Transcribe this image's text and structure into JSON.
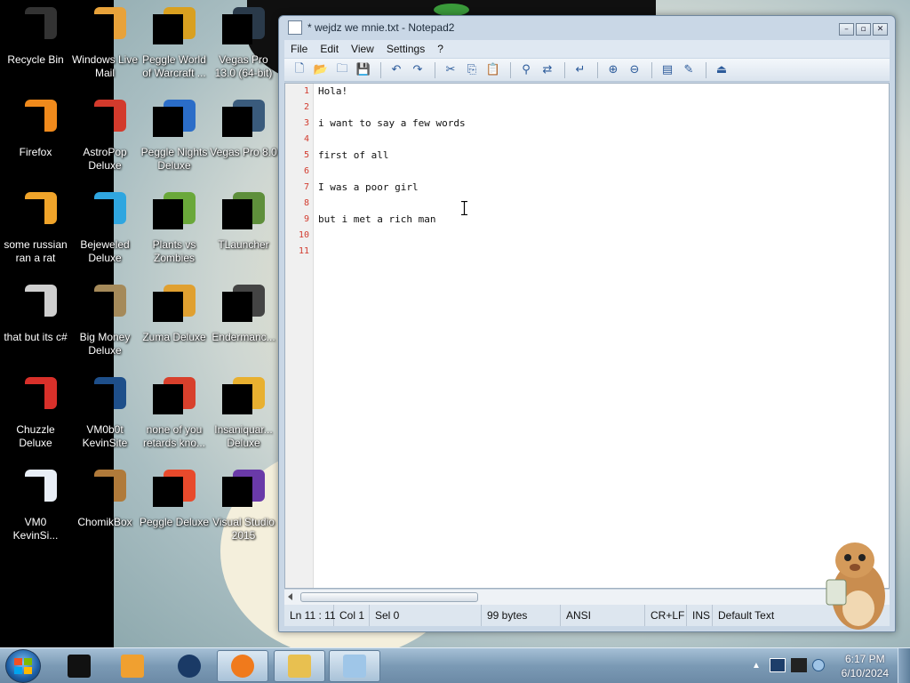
{
  "desktop": {
    "icons": [
      {
        "name": "recycle-bin",
        "line1": "Recycle Bin",
        "line2": "",
        "color": "#333333"
      },
      {
        "name": "windows-live-mail",
        "line1": "Windows Live",
        "line2": "Mail",
        "color": "#e8a23a"
      },
      {
        "name": "peggle-world-of-warcraft",
        "line1": "Peggle World",
        "line2": "of Warcraft ...",
        "color": "#d9a020"
      },
      {
        "name": "vegas-pro-13",
        "line1": "Vegas Pro",
        "line2": "13.0 (64-bit)",
        "color": "#2a3a4a"
      },
      {
        "name": "firefox",
        "line1": "Firefox",
        "line2": "",
        "color": "#f08a1c"
      },
      {
        "name": "astropop-deluxe",
        "line1": "AstroPop",
        "line2": "Deluxe",
        "color": "#d33a2c"
      },
      {
        "name": "peggle-nights-deluxe",
        "line1": "Peggle Nights",
        "line2": "Deluxe",
        "color": "#2b6dc8"
      },
      {
        "name": "vegas-pro-8",
        "line1": "Vegas Pro 8.0",
        "line2": "",
        "color": "#3a5b7c"
      },
      {
        "name": "some-russian-ran-a-rat",
        "line1": "some russian",
        "line2": "ran a rat",
        "color": "#f0a42a"
      },
      {
        "name": "bejeweled-deluxe",
        "line1": "Bejeweled",
        "line2": "Deluxe",
        "color": "#2fa6e0"
      },
      {
        "name": "plants-vs-zombies",
        "line1": "Plants vs",
        "line2": "Zombies",
        "color": "#6aa83a"
      },
      {
        "name": "tlauncher",
        "line1": "TLauncher",
        "line2": "",
        "color": "#5e8f3b"
      },
      {
        "name": "that-but-its-csharp",
        "line1": "that but its c#",
        "line2": "",
        "color": "#cfcfcf"
      },
      {
        "name": "big-money-deluxe",
        "line1": "Big Money",
        "line2": "Deluxe",
        "color": "#a58a5a"
      },
      {
        "name": "zuma-deluxe",
        "line1": "Zuma Deluxe",
        "line2": "",
        "color": "#e0a030"
      },
      {
        "name": "endermanch",
        "line1": "Endermanc...",
        "line2": "",
        "color": "#444444"
      },
      {
        "name": "chuzzle-deluxe",
        "line1": "Chuzzle",
        "line2": "Deluxe",
        "color": "#d8302a"
      },
      {
        "name": "vm0b0t-kevinsite",
        "line1": "VM0b0t",
        "line2": "KevinSite",
        "color": "#1e4f8a"
      },
      {
        "name": "none-of-you",
        "line1": "none of you",
        "line2": "retards kno...",
        "color": "#d8402c"
      },
      {
        "name": "insaniquarium-deluxe",
        "line1": "Insaniquar...",
        "line2": "Deluxe",
        "color": "#e8b030"
      },
      {
        "name": "vm0-kevinsite",
        "line1": "VM0",
        "line2": "KevinSi...",
        "color": "#e8eef6"
      },
      {
        "name": "chomikbox",
        "line1": "ChomikBox",
        "line2": "",
        "color": "#b07a3a"
      },
      {
        "name": "peggle-deluxe",
        "line1": "Peggle Deluxe",
        "line2": "",
        "color": "#e84a2c"
      },
      {
        "name": "visual-studio-2015",
        "line1": "Visual Studio",
        "line2": "2015",
        "color": "#6a3aa8"
      }
    ]
  },
  "window": {
    "title": "* wejdz we mnie.txt - Notepad2",
    "buttons": {
      "minimize": "–",
      "maximize": "▫",
      "close": "✕"
    }
  },
  "menu": [
    "File",
    "Edit",
    "View",
    "Settings",
    "?"
  ],
  "toolbar": [
    "new-icon",
    "open-icon",
    "browse-icon",
    "save-icon",
    "|",
    "undo-icon",
    "redo-icon",
    "|",
    "cut-icon",
    "copy-icon",
    "paste-icon",
    "|",
    "find-icon",
    "replace-icon",
    "|",
    "wordwrap-icon",
    "|",
    "zoom-in-icon",
    "zoom-out-icon",
    "|",
    "scheme-icon",
    "customize-icon",
    "|",
    "exit-icon"
  ],
  "editor": {
    "lines": [
      "Hola!",
      "",
      "i want to say a few words",
      "",
      "first of all",
      "",
      "I was a poor girl",
      "",
      "but i met a rich man",
      "",
      ""
    ],
    "line_numbers": [
      "1",
      "2",
      "3",
      "4",
      "5",
      "6",
      "7",
      "8",
      "9",
      "10",
      "11"
    ]
  },
  "status": {
    "position": "Ln 11 : 11",
    "col": "Col 1",
    "sel": "Sel 0",
    "size": "99 bytes",
    "encoding": "ANSI",
    "eol": "CR+LF",
    "mode": "INS",
    "scheme": "Default Text"
  },
  "taskbar": {
    "items": [
      {
        "name": "taskbar-item-blackbox",
        "icon": "black-box-icon",
        "active": false
      },
      {
        "name": "taskbar-item-media-player",
        "icon": "media-player-icon",
        "active": false
      },
      {
        "name": "taskbar-item-globe",
        "icon": "globe-icon",
        "active": false
      },
      {
        "name": "taskbar-item-firefox",
        "icon": "firefox-icon",
        "active": true
      },
      {
        "name": "taskbar-item-explorer",
        "icon": "folder-icon",
        "active": true
      },
      {
        "name": "taskbar-item-notepad2",
        "icon": "notepad-icon",
        "active": true
      }
    ],
    "clock": {
      "time": "6:17 PM",
      "date": "6/10/2024"
    }
  },
  "colors": {
    "line_number": "#d23b2e",
    "window_frame": "#c9d7e6",
    "taskbar": "#7b9ab5"
  }
}
